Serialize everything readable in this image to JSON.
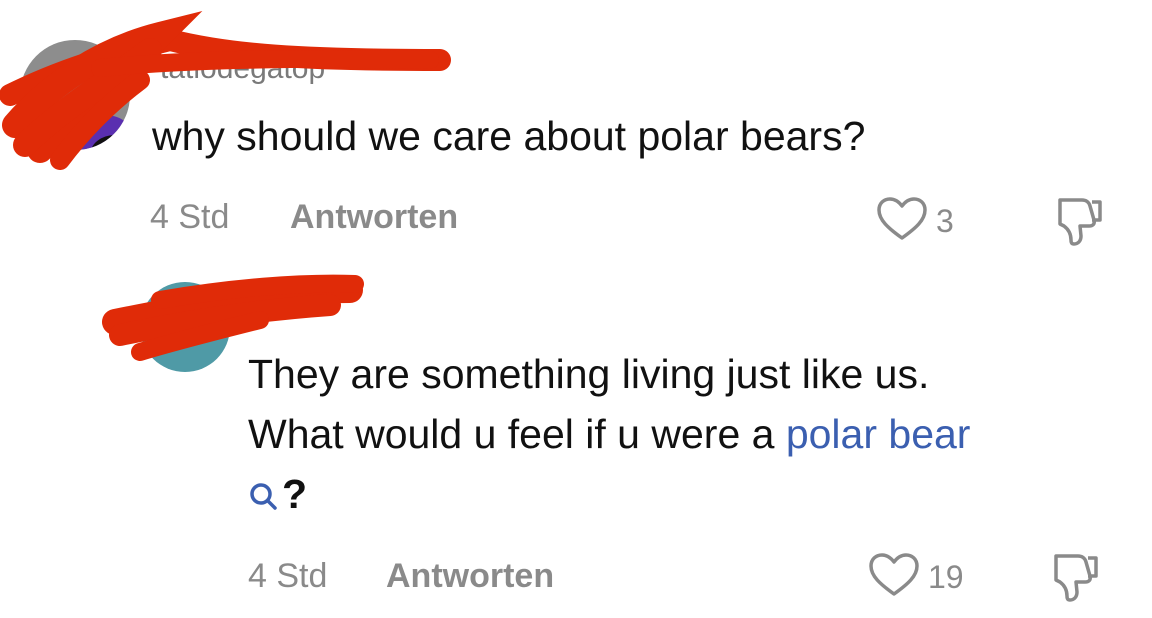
{
  "comments": [
    {
      "username": "tatiodegatop",
      "text": "why should we care about polar bears?",
      "time": "4 Std",
      "reply_label": "Antworten",
      "likes": "3"
    },
    {
      "text_part1": "They are something living just like us.",
      "text_part2": "What would u feel if u were a ",
      "link_text": "polar bear",
      "text_part3": "?",
      "time": "4 Std",
      "reply_label": "Antworten",
      "likes": "19"
    }
  ],
  "colors": {
    "redaction": "#e02b08",
    "link": "#3b5fb0",
    "meta": "#8a8a8a"
  },
  "icons": {
    "like": "heart-outline-icon",
    "dislike": "thumbs-down-icon",
    "search": "search-icon"
  }
}
